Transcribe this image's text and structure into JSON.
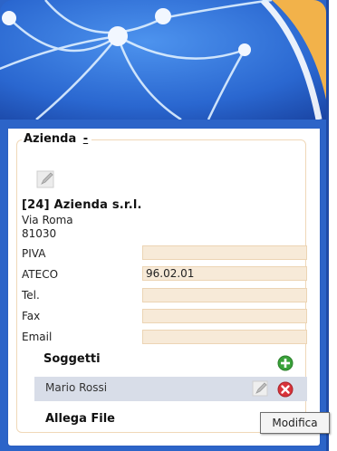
{
  "fieldset": {
    "legend": "Azienda",
    "toggle": "-"
  },
  "company": {
    "title": "[24] Azienda s.r.l.",
    "street": "Via Roma",
    "zip": "81030"
  },
  "fields": [
    {
      "label": "PIVA",
      "value": ""
    },
    {
      "label": "ATECO",
      "value": "96.02.01"
    },
    {
      "label": "Tel.",
      "value": ""
    },
    {
      "label": "Fax",
      "value": ""
    },
    {
      "label": "Email",
      "value": ""
    }
  ],
  "soggetti": {
    "title": "Soggetti",
    "items": [
      {
        "name": "Mario Rossi"
      }
    ]
  },
  "allega": {
    "title": "Allega File"
  },
  "tooltip": {
    "text": "Modifica"
  },
  "colors": {
    "frame": "#2c64c8",
    "field_bg": "#f7ead8",
    "row_bg": "#d8dde8"
  },
  "icons": [
    "edit-icon",
    "add-icon",
    "delete-icon"
  ]
}
